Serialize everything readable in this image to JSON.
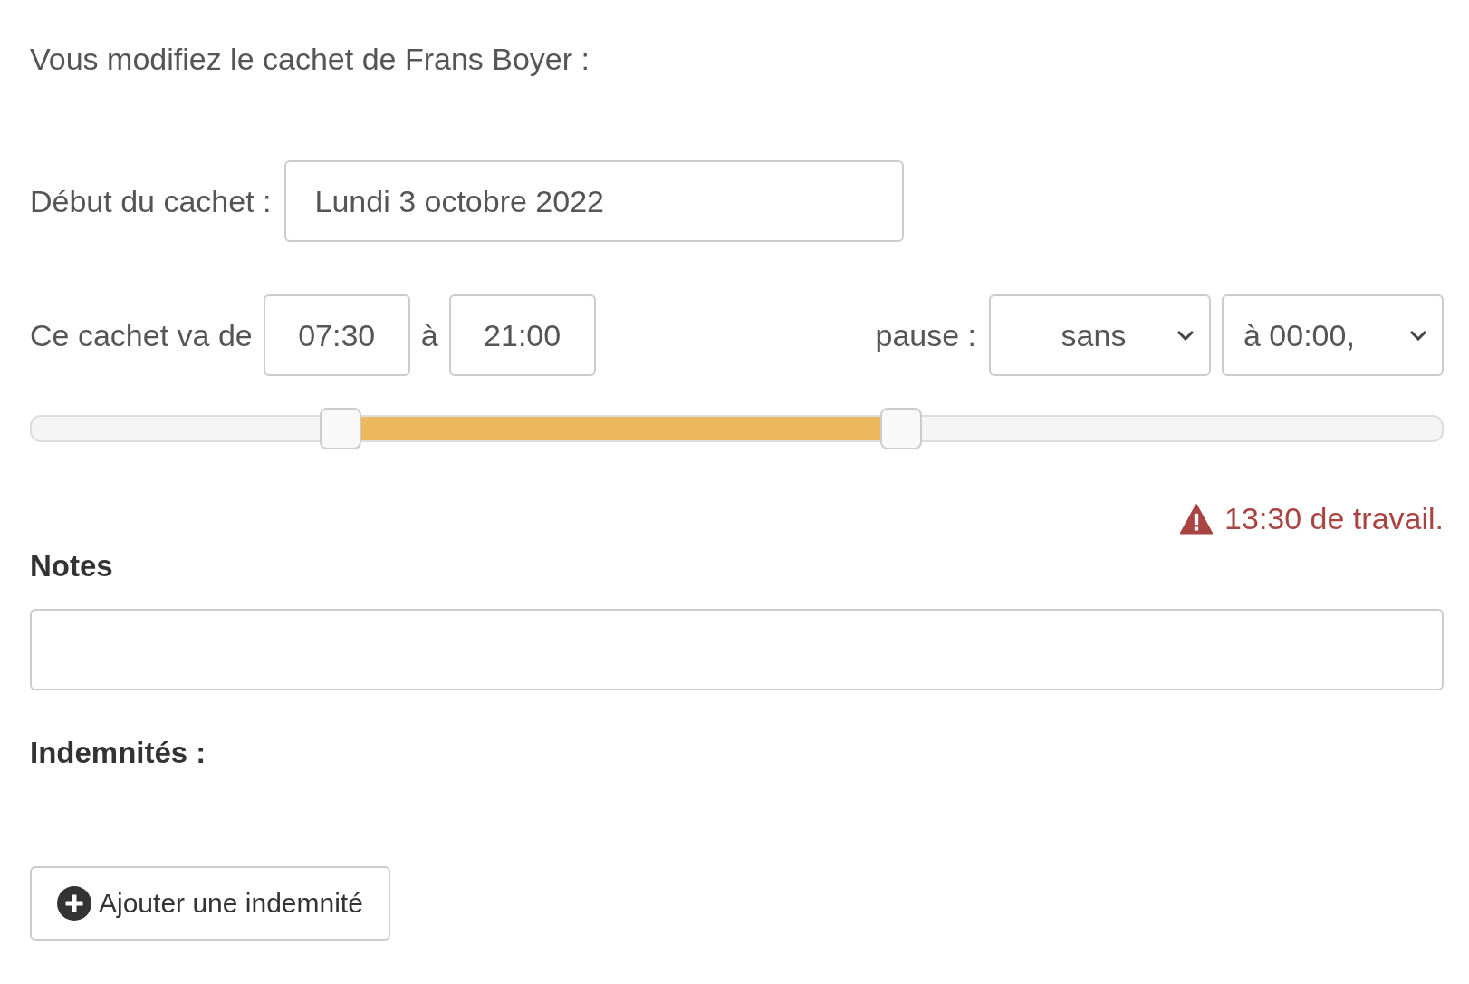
{
  "intro": "Vous modifiez le cachet de Frans Boyer :",
  "start_date": {
    "label": "Début du cachet :",
    "value": "Lundi 3 octobre 2022"
  },
  "hours": {
    "label": "Ce cachet va de",
    "from": "07:30",
    "separator": "à",
    "to": "21:00"
  },
  "pause": {
    "label": "pause :",
    "duration": "sans",
    "time": "à 00:00,"
  },
  "range": {
    "start": {
      "level": 0.22
    },
    "end": {
      "level": 0.616
    }
  },
  "warning": {
    "text": "13:30 de travail."
  },
  "notes": {
    "label": "Notes"
  },
  "allowances": {
    "label": "Indemnités :"
  },
  "add_button": {
    "label": "Ajouter une indemnité"
  }
}
